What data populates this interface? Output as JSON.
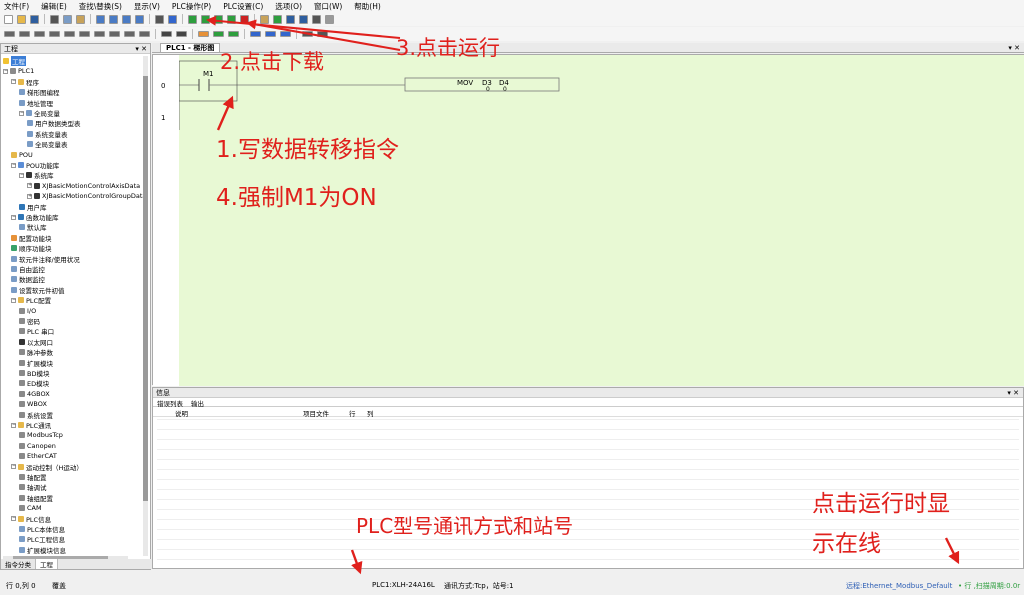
{
  "menu": [
    "文件(F)",
    "编辑(E)",
    "查找\\替换(S)",
    "显示(V)",
    "PLC操作(P)",
    "PLC设置(C)",
    "选项(O)",
    "窗口(W)",
    "帮助(H)"
  ],
  "project_panel": {
    "title": "工程",
    "pin": "▾ ✕",
    "tabs": [
      "指令分类",
      "工程"
    ]
  },
  "tree": [
    {
      "label": "工程",
      "level": 0,
      "toggle": "",
      "sel": true,
      "color": "#f1c232"
    },
    {
      "label": "PLC1",
      "level": 0,
      "toggle": "−",
      "color": "#8a8a8a"
    },
    {
      "label": "程序",
      "level": 1,
      "toggle": "−",
      "color": "#e6b84a"
    },
    {
      "label": "梯形图编程",
      "level": 2,
      "toggle": "",
      "color": "#7a9cc6"
    },
    {
      "label": "地址管理",
      "level": 2,
      "toggle": "",
      "color": "#7a9cc6"
    },
    {
      "label": "全局变量",
      "level": 2,
      "toggle": "−",
      "color": "#7a9cc6"
    },
    {
      "label": "用户数据类型表",
      "level": 3,
      "toggle": "",
      "color": "#7a9cc6"
    },
    {
      "label": "系统变量表",
      "level": 3,
      "toggle": "",
      "color": "#7a9cc6"
    },
    {
      "label": "全局变量表",
      "level": 3,
      "toggle": "",
      "color": "#7a9cc6"
    },
    {
      "label": "POU",
      "level": 1,
      "toggle": "",
      "color": "#e6b84a"
    },
    {
      "label": "POU功能库",
      "level": 1,
      "toggle": "−",
      "color": "#5b8dd6"
    },
    {
      "label": "系统库",
      "level": 2,
      "toggle": "−",
      "color": "#333333"
    },
    {
      "label": "XJBasicMotionControlAxisData",
      "level": 3,
      "toggle": "+",
      "color": "#333333"
    },
    {
      "label": "XJBasicMotionControlGroupData",
      "level": 3,
      "toggle": "+",
      "color": "#333333"
    },
    {
      "label": "用户库",
      "level": 2,
      "toggle": "",
      "color": "#2e75b6"
    },
    {
      "label": "函数功能库",
      "level": 1,
      "toggle": "−",
      "color": "#2e75b6"
    },
    {
      "label": "默认库",
      "level": 2,
      "toggle": "",
      "color": "#7a9cc6"
    },
    {
      "label": "配置功能块",
      "level": 1,
      "toggle": "",
      "color": "#e69138"
    },
    {
      "label": "顺序功能块",
      "level": 1,
      "toggle": "",
      "color": "#38a169"
    },
    {
      "label": "软元件注释/使用状况",
      "level": 1,
      "toggle": "",
      "color": "#7a9cc6"
    },
    {
      "label": "自由监控",
      "level": 1,
      "toggle": "",
      "color": "#7a9cc6"
    },
    {
      "label": "数据监控",
      "level": 1,
      "toggle": "",
      "color": "#7a9cc6"
    },
    {
      "label": "设置软元件初值",
      "level": 1,
      "toggle": "",
      "color": "#7a9cc6"
    },
    {
      "label": "PLC配置",
      "level": 1,
      "toggle": "−",
      "color": "#e6b84a"
    },
    {
      "label": "I/O",
      "level": 2,
      "toggle": "",
      "color": "#8a8a8a"
    },
    {
      "label": "密码",
      "level": 2,
      "toggle": "",
      "color": "#8a8a8a"
    },
    {
      "label": "PLC 串口",
      "level": 2,
      "toggle": "",
      "color": "#8a8a8a"
    },
    {
      "label": "以太网口",
      "level": 2,
      "toggle": "",
      "color": "#333333"
    },
    {
      "label": "脉冲参数",
      "level": 2,
      "toggle": "",
      "color": "#8a8a8a"
    },
    {
      "label": "扩展模块",
      "level": 2,
      "toggle": "",
      "color": "#8a8a8a"
    },
    {
      "label": "BD模块",
      "level": 2,
      "toggle": "",
      "color": "#8a8a8a"
    },
    {
      "label": "ED模块",
      "level": 2,
      "toggle": "",
      "color": "#8a8a8a"
    },
    {
      "label": "4GBOX",
      "level": 2,
      "toggle": "",
      "color": "#8a8a8a"
    },
    {
      "label": "WBOX",
      "level": 2,
      "toggle": "",
      "color": "#8a8a8a"
    },
    {
      "label": "系统设置",
      "level": 2,
      "toggle": "",
      "color": "#8a8a8a"
    },
    {
      "label": "PLC通讯",
      "level": 1,
      "toggle": "−",
      "color": "#e6b84a"
    },
    {
      "label": "ModbusTcp",
      "level": 2,
      "toggle": "",
      "color": "#8a8a8a"
    },
    {
      "label": "Canopen",
      "level": 2,
      "toggle": "",
      "color": "#8a8a8a"
    },
    {
      "label": "EtherCAT",
      "level": 2,
      "toggle": "",
      "color": "#8a8a8a"
    },
    {
      "label": "运动控制（H运动）",
      "level": 1,
      "toggle": "−",
      "color": "#e6b84a"
    },
    {
      "label": "轴配置",
      "level": 2,
      "toggle": "",
      "color": "#8a8a8a"
    },
    {
      "label": "轴调试",
      "level": 2,
      "toggle": "",
      "color": "#8a8a8a"
    },
    {
      "label": "轴组配置",
      "level": 2,
      "toggle": "",
      "color": "#8a8a8a"
    },
    {
      "label": "CAM",
      "level": 2,
      "toggle": "",
      "color": "#8a8a8a"
    },
    {
      "label": "PLC信息",
      "level": 1,
      "toggle": "−",
      "color": "#e6b84a"
    },
    {
      "label": "PLC本体信息",
      "level": 2,
      "toggle": "",
      "color": "#7a9cc6"
    },
    {
      "label": "PLC工程信息",
      "level": 2,
      "toggle": "",
      "color": "#7a9cc6"
    },
    {
      "label": "扩展模块信息",
      "level": 2,
      "toggle": "",
      "color": "#7a9cc6"
    }
  ],
  "toolbar1": [
    {
      "icon": "new-file-icon",
      "color": "#ffffff"
    },
    {
      "icon": "open-folder-icon",
      "color": "#e6b84a"
    },
    {
      "icon": "save-icon",
      "color": "#2e5e9e"
    },
    {
      "icon": "cut-icon",
      "color": "#555555"
    },
    {
      "icon": "copy-icon",
      "color": "#7a9cc6"
    },
    {
      "icon": "paste-icon",
      "color": "#c7a25a"
    },
    {
      "icon": "undo-icon",
      "color": "#4a7bc4"
    },
    {
      "icon": "redo-icon",
      "color": "#4a7bc4"
    },
    {
      "icon": "find-icon",
      "color": "#4a7bc4"
    },
    {
      "icon": "replace-icon",
      "color": "#4a7bc4"
    },
    {
      "icon": "print-icon",
      "color": "#555555"
    },
    {
      "icon": "help-icon",
      "color": "#3366cc"
    },
    {
      "icon": "download-icon",
      "color": "#2e9e3e"
    },
    {
      "icon": "upload-icon",
      "color": "#2e9e3e"
    },
    {
      "icon": "upload-compare-icon",
      "color": "#2e9e3e"
    },
    {
      "icon": "run-icon",
      "color": "#2e9e3e"
    },
    {
      "icon": "stop-icon",
      "color": "#cc2222"
    },
    {
      "icon": "lock-icon",
      "color": "#c7a25a"
    },
    {
      "icon": "monitor-icon",
      "color": "#2e9e3e"
    },
    {
      "icon": "monitor-write-icon",
      "color": "#2e5e9e"
    },
    {
      "icon": "plc-online-icon",
      "color": "#2e5e9e"
    },
    {
      "icon": "memory-icon",
      "color": "#555555"
    },
    {
      "icon": "warning-icon",
      "color": "#999999"
    }
  ],
  "toolbar2": [
    {
      "icon": "ladder-contact-no-icon",
      "color": "#666666"
    },
    {
      "icon": "ladder-contact-nc-icon",
      "color": "#666666"
    },
    {
      "icon": "ladder-contact-rise-icon",
      "color": "#666666"
    },
    {
      "icon": "ladder-contact-fall-icon",
      "color": "#666666"
    },
    {
      "icon": "ladder-parallel-icon",
      "color": "#666666"
    },
    {
      "icon": "ladder-coil-icon",
      "color": "#666666"
    },
    {
      "icon": "ladder-hline-icon",
      "color": "#666666"
    },
    {
      "icon": "ladder-vline-icon",
      "color": "#666666"
    },
    {
      "icon": "ladder-instruction-icon",
      "color": "#666666"
    },
    {
      "icon": "ladder-delete-line-icon",
      "color": "#666666"
    },
    {
      "icon": "arrow-up-icon",
      "color": "#444444"
    },
    {
      "icon": "arrow-down-icon",
      "color": "#444444"
    },
    {
      "icon": "text-t-icon",
      "color": "#e69138"
    },
    {
      "icon": "color-icon",
      "color": "#2e9e3e"
    },
    {
      "icon": "s-icon",
      "color": "#2e9e3e"
    },
    {
      "icon": "zoom-fit-icon",
      "color": "#3366cc"
    },
    {
      "icon": "zoom-in-icon",
      "color": "#3366cc"
    },
    {
      "icon": "zoom-out-icon",
      "color": "#3366cc"
    },
    {
      "icon": "grid-icon",
      "color": "#555555"
    },
    {
      "icon": "settings-icon",
      "color": "#555555"
    }
  ],
  "editor": {
    "tab": "PLC1 - 梯形图",
    "close": "▾ ✕",
    "row0": "0",
    "row1": "1",
    "contact": "M1",
    "instruction": {
      "op": "MOV",
      "src": "D3",
      "dst": "D4",
      "src_val": "0",
      "dst_val": "0"
    }
  },
  "info": {
    "title": "信息",
    "close": "▾ ✕",
    "tabs": [
      "错误列表",
      "输出"
    ],
    "columns": [
      "说明",
      "项目文件",
      "行",
      "列"
    ]
  },
  "status": {
    "pos": "行 0,列 0",
    "mode": "覆盖",
    "plc": "PLC1:XLH-24A16L",
    "comm": "通讯方式:Tcp，站号:1",
    "remote": "远程:Ethernet_Modbus_Default",
    "run": "• 行 ,扫描周期:0.0r"
  },
  "annotations": {
    "step1": "1.写数据转移指令",
    "step2": "2.点击下载",
    "step3": "3.点击运行",
    "step4": "4.强制M1为ON",
    "plc_note": "PLC型号通讯方式和站号",
    "online_note_1": "点击运行时显",
    "online_note_2": "示在线",
    "color": "#e0201c"
  }
}
